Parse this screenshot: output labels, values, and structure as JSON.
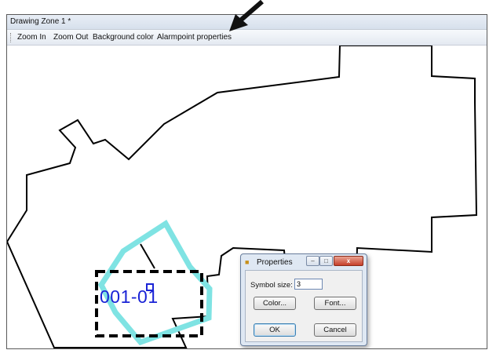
{
  "window": {
    "title": "Drawing Zone 1 *"
  },
  "toolbar": {
    "zoom_in": "Zoom In",
    "zoom_out": "Zoom Out",
    "background_color": "Background color",
    "alarmpoint_properties": "Alarmpoint properties"
  },
  "canvas": {
    "zone_label": "001-01",
    "colors": {
      "outline": "#000000",
      "zone_highlight": "#7fe3e3",
      "label": "#1a23d6",
      "selection": "#000000"
    }
  },
  "properties_dialog": {
    "title": "Properties",
    "caption_buttons": {
      "minimize": "–",
      "maximize": "□",
      "close": "x"
    },
    "symbol_size_label": "Symbol size:",
    "symbol_size_value": "3",
    "color_button": "Color...",
    "font_button": "Font...",
    "ok_button": "OK",
    "cancel_button": "Cancel"
  }
}
